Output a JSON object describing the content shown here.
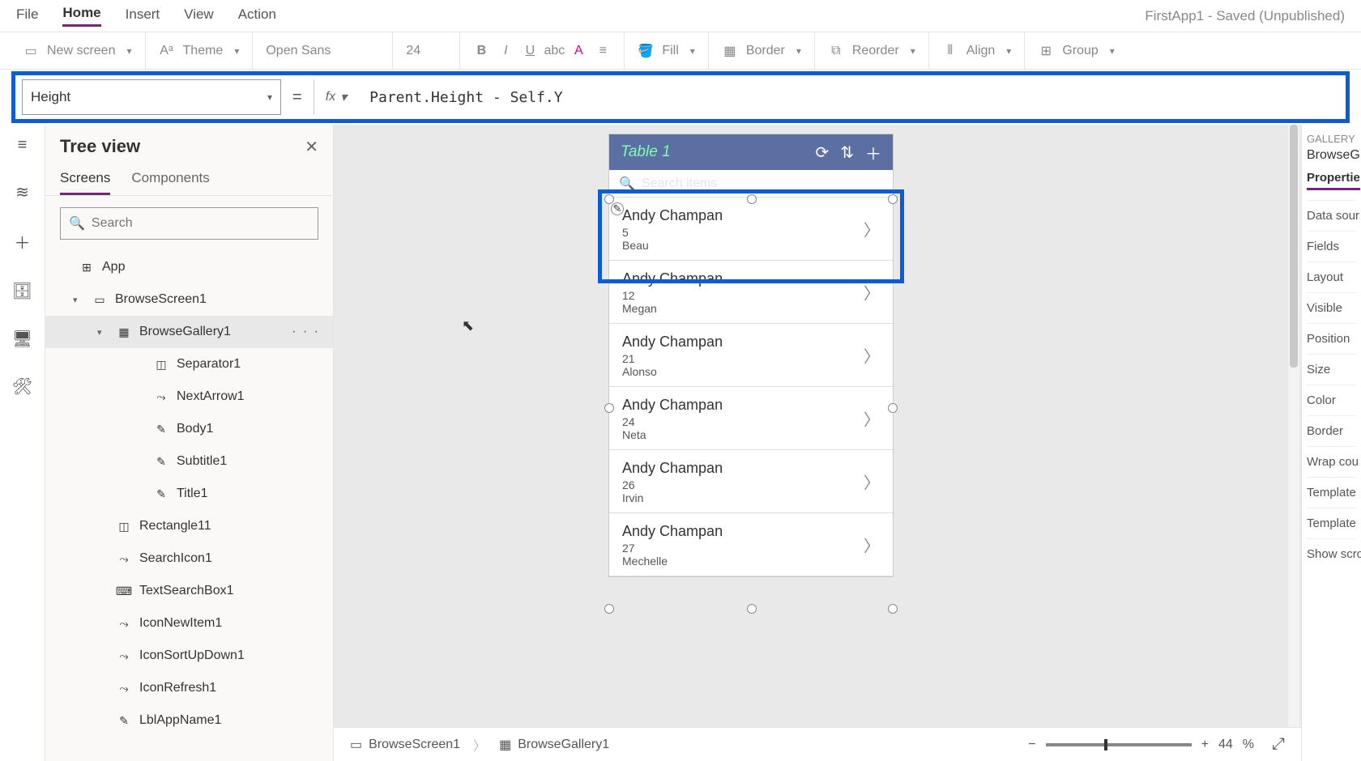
{
  "menu": {
    "items": [
      "File",
      "Home",
      "Insert",
      "View",
      "Action"
    ],
    "active": "Home",
    "status": "FirstApp1 - Saved (Unpublished)"
  },
  "ribbon": {
    "newscreen": "New screen",
    "theme": "Theme",
    "font": "Open Sans",
    "size": "24",
    "fill": "Fill",
    "border": "Border",
    "reorder": "Reorder",
    "align": "Align",
    "group": "Group"
  },
  "formula": {
    "property": "Height",
    "equals": "=",
    "fx": "fx",
    "value": "Parent.Height - Self.Y"
  },
  "tree": {
    "title": "Tree view",
    "tabs": {
      "screens": "Screens",
      "components": "Components"
    },
    "search_placeholder": "Search",
    "app": "App",
    "items": [
      {
        "name": "BrowseScreen1",
        "indent": 1,
        "chev": "▾",
        "icon": "▭"
      },
      {
        "name": "BrowseGallery1",
        "indent": 2,
        "chev": "▾",
        "icon": "▦",
        "selected": true,
        "dots": "· · ·"
      },
      {
        "name": "Separator1",
        "indent": 3,
        "icon": "◫"
      },
      {
        "name": "NextArrow1",
        "indent": 3,
        "icon": "⤳"
      },
      {
        "name": "Body1",
        "indent": 3,
        "icon": "✎"
      },
      {
        "name": "Subtitle1",
        "indent": 3,
        "icon": "✎"
      },
      {
        "name": "Title1",
        "indent": 3,
        "icon": "✎"
      },
      {
        "name": "Rectangle11",
        "indent": 2,
        "icon": "◫"
      },
      {
        "name": "SearchIcon1",
        "indent": 2,
        "icon": "⤳"
      },
      {
        "name": "TextSearchBox1",
        "indent": 2,
        "icon": "⌨"
      },
      {
        "name": "IconNewItem1",
        "indent": 2,
        "icon": "⤳"
      },
      {
        "name": "IconSortUpDown1",
        "indent": 2,
        "icon": "⤳"
      },
      {
        "name": "IconRefresh1",
        "indent": 2,
        "icon": "⤳"
      },
      {
        "name": "LblAppName1",
        "indent": 2,
        "icon": "✎"
      }
    ]
  },
  "phone": {
    "title": "Table 1",
    "search_placeholder": "Search items",
    "items": [
      {
        "title": "Andy Champan",
        "sub": "5",
        "body": "Beau"
      },
      {
        "title": "Andy Champan",
        "sub": "12",
        "body": "Megan"
      },
      {
        "title": "Andy Champan",
        "sub": "21",
        "body": "Alonso"
      },
      {
        "title": "Andy Champan",
        "sub": "24",
        "body": "Neta"
      },
      {
        "title": "Andy Champan",
        "sub": "26",
        "body": "Irvin"
      },
      {
        "title": "Andy Champan",
        "sub": "27",
        "body": "Mechelle"
      }
    ]
  },
  "breadcrumb": {
    "screen": "BrowseScreen1",
    "control": "BrowseGallery1"
  },
  "zoom": {
    "value": "44",
    "pct": "%"
  },
  "props": {
    "type": "GALLERY",
    "name": "BrowseG",
    "tab": "Propertie",
    "rows": [
      "Data sour",
      "Fields",
      "Layout",
      "Visible",
      "Position",
      "Size",
      "Color",
      "Border",
      "Wrap cou",
      "Template",
      "Template",
      "Show scro"
    ]
  }
}
